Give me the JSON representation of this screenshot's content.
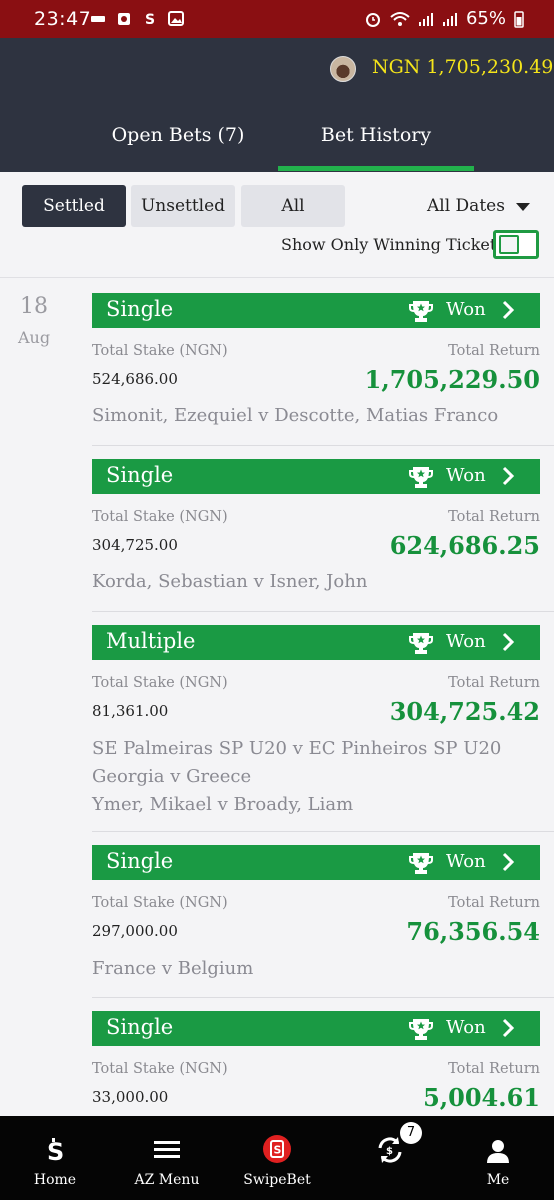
{
  "status_bar": {
    "time": "23:47",
    "battery": "65%",
    "left_icons": [
      "sim-icon",
      "camera-icon",
      "app-s-icon",
      "image-icon"
    ],
    "right_icons": [
      "alarm-icon",
      "wifi-icon",
      "signal-icon",
      "signal-icon",
      "battery-icon"
    ]
  },
  "header": {
    "balance": "NGN 1,705,230.49",
    "tabs": [
      {
        "label": "Open Bets (7)",
        "active": false
      },
      {
        "label": "Bet History",
        "active": true
      }
    ]
  },
  "filters": {
    "buttons": [
      {
        "label": "Settled",
        "active": true
      },
      {
        "label": "Unsettled",
        "active": false
      },
      {
        "label": "All",
        "active": false
      }
    ],
    "date_filter": "All Dates",
    "winning_only_label": "Show Only Winning Tickets",
    "winning_only_enabled": false
  },
  "date_group": {
    "day": "18",
    "month": "Aug"
  },
  "labels": {
    "stake": "Total Stake (NGN)",
    "return": "Total Return"
  },
  "bets": [
    {
      "type": "Single",
      "status": "Won",
      "stake": "524,686.00",
      "return": "1,705,229.50",
      "events": [
        "Simonit, Ezequiel v Descotte, Matias Franco"
      ]
    },
    {
      "type": "Single",
      "status": "Won",
      "stake": "304,725.00",
      "return": "624,686.25",
      "events": [
        "Korda, Sebastian v Isner, John"
      ]
    },
    {
      "type": "Multiple",
      "status": "Won",
      "stake": "81,361.00",
      "return": "304,725.42",
      "events": [
        "SE Palmeiras SP U20 v EC Pinheiros SP U20",
        "Georgia v Greece",
        "Ymer, Mikael v Broady, Liam"
      ]
    },
    {
      "type": "Single",
      "status": "Won",
      "stake": "297,000.00",
      "return": "76,356.54",
      "events": [
        "France v Belgium"
      ]
    },
    {
      "type": "Single",
      "status": "Won",
      "stake": "33,000.00",
      "return": "5,004.61",
      "events": []
    }
  ],
  "bottom_nav": [
    {
      "label": "Home",
      "icon": "s-logo-icon"
    },
    {
      "label": "AZ Menu",
      "icon": "menu-icon"
    },
    {
      "label": "SwipeBet",
      "icon": "swipebet-icon"
    },
    {
      "label": "",
      "icon": "bet-exchange-icon",
      "badge": "7"
    },
    {
      "label": "Me",
      "icon": "user-icon"
    }
  ],
  "colors": {
    "accent_green": "#1a9a44",
    "header_dark": "#2e3340",
    "status_red": "#8a0f12",
    "balance_yellow": "#f5e51a"
  }
}
